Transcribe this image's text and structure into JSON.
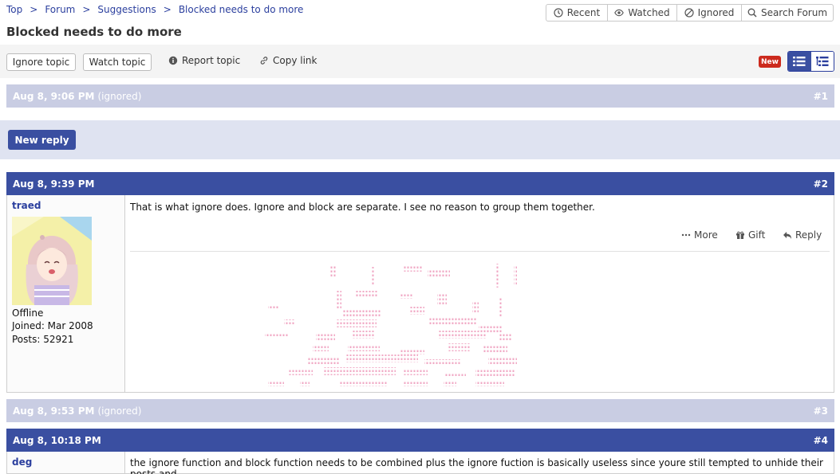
{
  "breadcrumb": {
    "items": [
      "Top",
      "Forum",
      "Suggestions",
      "Blocked needs to do more"
    ],
    "separator": ">"
  },
  "topnav": {
    "recent": "Recent",
    "watched": "Watched",
    "ignored": "Ignored",
    "search": "Search Forum"
  },
  "page": {
    "title": "Blocked needs to do more"
  },
  "actions": {
    "ignore_topic": "Ignore topic",
    "watch_topic": "Watch topic",
    "report_topic": "Report topic",
    "copy_link": "Copy link",
    "new_badge": "New"
  },
  "reply": {
    "new_reply": "New reply"
  },
  "posts": [
    {
      "time": "Aug 8, 9:06 PM",
      "status": "(ignored)",
      "number": "#1"
    },
    {
      "time": "Aug 8, 9:39 PM",
      "number": "#2",
      "author": "traed",
      "presence": "Offline",
      "joined": "Joined: Mar 2008",
      "posts": "Posts: 52921",
      "text": "That is what ignore does. Ignore and block are separate. I see no reason to group them together.",
      "more": "More",
      "gift": "Gift",
      "reply": "Reply"
    },
    {
      "time": "Aug 8, 9:53 PM",
      "status": "(ignored)",
      "number": "#3"
    },
    {
      "time": "Aug 8, 10:18 PM",
      "number": "#4",
      "author": "deg",
      "text": "the ignore function and block function needs to be combined plus the ignore fuction is basically useless since youre still tempted to unhide their posts and"
    }
  ],
  "colors": {
    "link": "#2b3f9e",
    "header_active": "#3a4fa1",
    "header_ignored": "#c9cde3",
    "reply_band": "#dfe3f1",
    "new_badge": "#cc2a1d",
    "signature": "#f0a8c4"
  }
}
